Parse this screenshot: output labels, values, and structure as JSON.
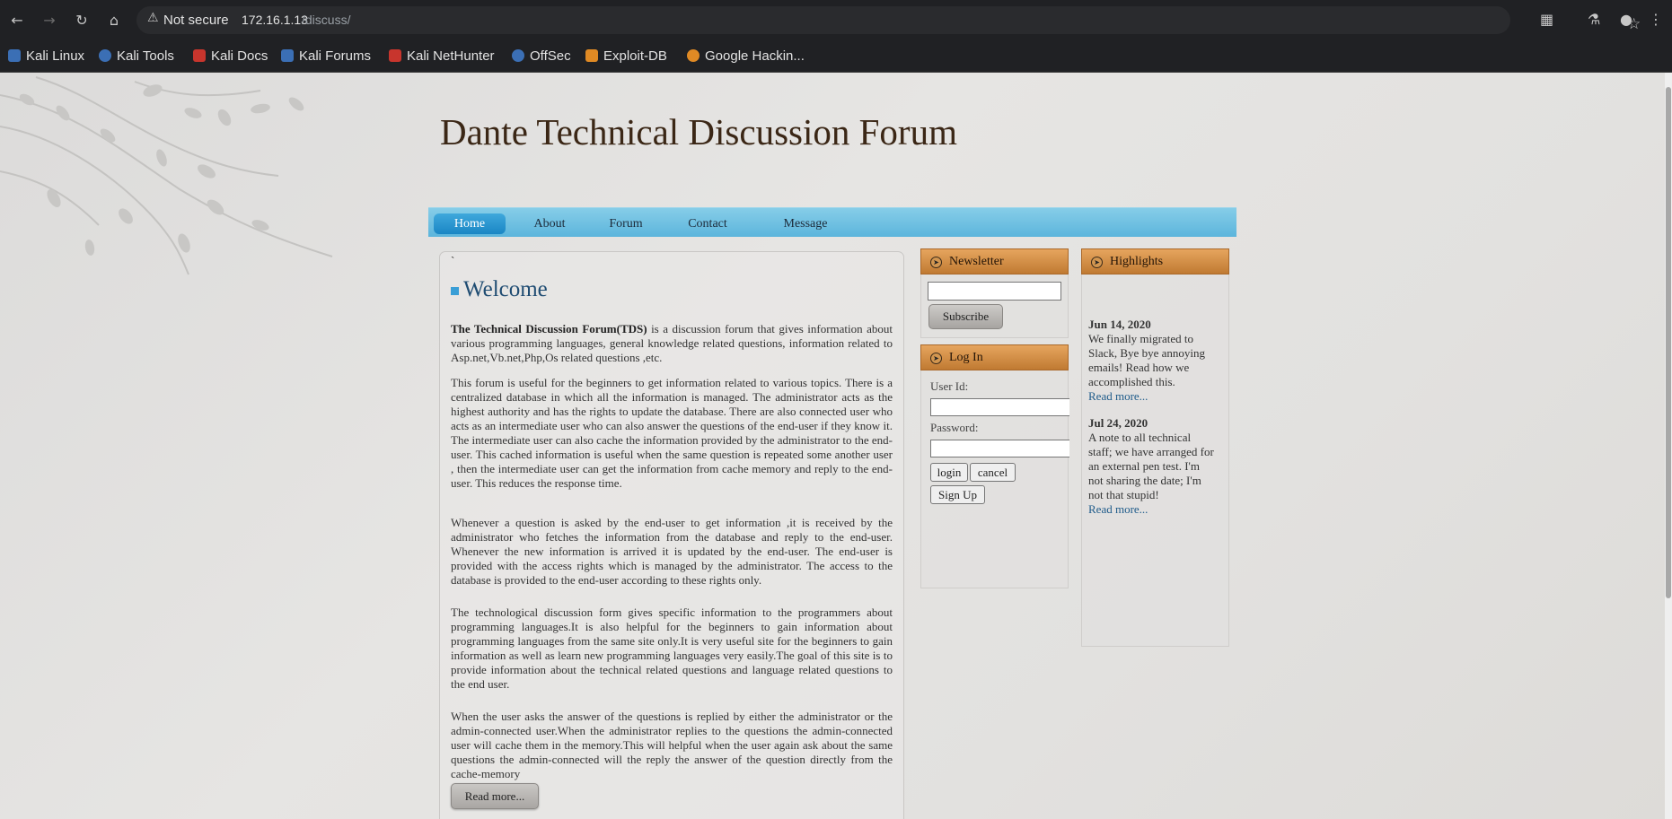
{
  "browser": {
    "security_label": "Not secure",
    "url_host": "172.16.1.13",
    "url_path": "/discuss/",
    "icons": [
      "back-icon",
      "forward-icon",
      "reload-icon",
      "home-icon",
      "warning-icon",
      "star-icon",
      "extensions-icon",
      "labs-icon",
      "profile-icon",
      "menu-icon"
    ],
    "bookmarks": [
      {
        "label": "Kali Linux",
        "color": "#3b6fb5"
      },
      {
        "label": "Kali Tools",
        "color": "#3b6fb5"
      },
      {
        "label": "Kali Docs",
        "color": "#c8352d"
      },
      {
        "label": "Kali Forums",
        "color": "#3b6fb5"
      },
      {
        "label": "Kali NetHunter",
        "color": "#c8352d"
      },
      {
        "label": "OffSec",
        "color": "#3b6fb5"
      },
      {
        "label": "Exploit-DB",
        "color": "#e08a24"
      },
      {
        "label": "Google Hackin...",
        "color": "#e08a24"
      }
    ]
  },
  "site": {
    "title": "Dante Technical Discussion Forum",
    "menu": [
      "Home",
      "About",
      "Forum",
      "Contact",
      "Message"
    ]
  },
  "main": {
    "backtick": "`",
    "heading": "Welcome",
    "intro_bold": "The Technical Discussion Forum(TDS)",
    "intro_rest": " is a discussion forum that gives information about various programming languages, general knowledge related questions, information related to Asp.net,Vb.net,Php,Os related questions ,etc.",
    "para2": "This forum is useful for the beginners to get information related to various topics. There is a centralized database in which all the information is managed. The administrator acts as the highest authority and has the rights to update the database. There are also connected user who acts as an intermediate user who can also answer the questions of the end-user if they know it. The intermediate user can also cache the information provided by the administrator to the end-user. This cached information is useful when the same question is repeated some another user , then the intermediate user can get the information from cache memory and reply to the end-user. This reduces the response time.",
    "para3": "Whenever a question is asked by the end-user to get information ,it is received by the administrator who fetches the information from the database and reply to the end-user. Whenever the new information is arrived it is updated by the end-user. The end-user is provided with the access rights which is managed by the administrator. The access to the database is provided to the end-user according to these rights only.",
    "para4": "The technological discussion form gives specific information to the programmers about programming languages.It is also helpful for the beginners to gain information about programming languages from the same site only.It is very useful site for the beginners to gain information as well as learn new programming languages very easily.The goal of this site is to provide information about the technical related questions and language related questions to the end user.",
    "para5": "When the user asks the answer of the questions is replied by either the administrator or the admin-connected user.When the administrator replies to the questions the admin-connected user will cache them in the memory.This will helpful when the user again ask about the same questions the admin-connected will the reply the answer of the question directly from the cache-memory",
    "read_more": "Read more..."
  },
  "newsletter": {
    "title": "Newsletter",
    "input_value": "",
    "subscribe": "Subscribe"
  },
  "login": {
    "title": "Log In",
    "user_label": "User Id:",
    "password_label": "Password:",
    "login_btn": "login",
    "cancel_btn": "cancel",
    "signup_btn": "Sign Up"
  },
  "highlights": {
    "title": "Highlights",
    "items": [
      {
        "date": "Jun 14, 2020",
        "text": "We finally migrated to Slack, Bye bye annoying emails! Read how we accomplished this.",
        "link": "Read more..."
      },
      {
        "date": "Jul 24, 2020",
        "text": "A note to all technical staff; we have arranged for an external pen test. I'm not sharing the date; I'm not that stupid!",
        "link": "Read more..."
      }
    ]
  }
}
